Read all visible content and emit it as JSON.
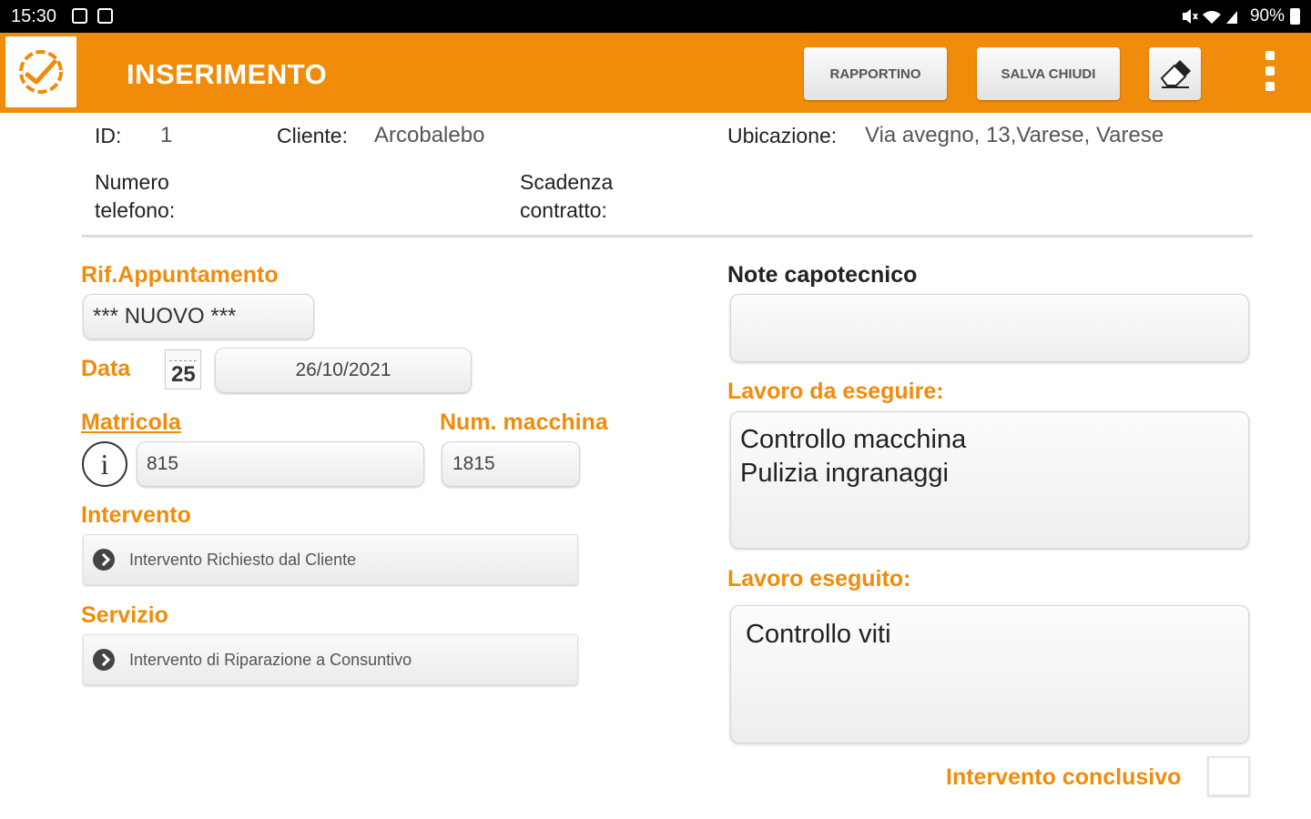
{
  "status_bar": {
    "time": "15:30",
    "battery": "90%"
  },
  "app_bar": {
    "title": "INSERIMENTO",
    "rapportino_label": "RAPPORTINO",
    "salva_chiudi_label": "SALVA CHIUDI",
    "logo_icon": "check-gear-icon",
    "eraser_icon": "eraser-icon",
    "menu_icon": "more-vert-icon"
  },
  "header": {
    "id_label": "ID:",
    "id_value": "1",
    "cliente_label": "Cliente:",
    "cliente_value": "Arcobalebo",
    "ubicazione_label": "Ubicazione:",
    "ubicazione_value": "Via avegno, 13,Varese, Varese",
    "telefono_label_1": "Numero",
    "telefono_label_2": "telefono:",
    "scadenza_label_1": "Scadenza",
    "scadenza_label_2": "contratto:"
  },
  "form": {
    "rif_label": "Rif.Appuntamento",
    "rif_value": "*** NUOVO ***",
    "data_label": "Data",
    "calendar_day": "25",
    "data_value": "26/10/2021",
    "matricola_label": "Matricola",
    "matricola_value": "815",
    "num_macchina_label": "Num. macchina",
    "num_macchina_value": "1815",
    "intervento_label": "Intervento",
    "intervento_value": "Intervento Richiesto dal Cliente",
    "servizio_label": "Servizio",
    "servizio_value": "Intervento di Riparazione a Consuntivo",
    "note_label": "Note capotecnico",
    "note_value": "",
    "lavoro_da_label": "Lavoro da eseguire:",
    "lavoro_da_lines": [
      "Controllo macchina",
      "Pulizia ingranaggi"
    ],
    "lavoro_eseguito_label": "Lavoro eseguito:",
    "lavoro_eseguito_value": "Controllo viti",
    "conclusivo_label": "Intervento conclusivo",
    "conclusivo_checked": false
  },
  "colors": {
    "accent": "#f08c0a",
    "status_bar": "#000000"
  }
}
